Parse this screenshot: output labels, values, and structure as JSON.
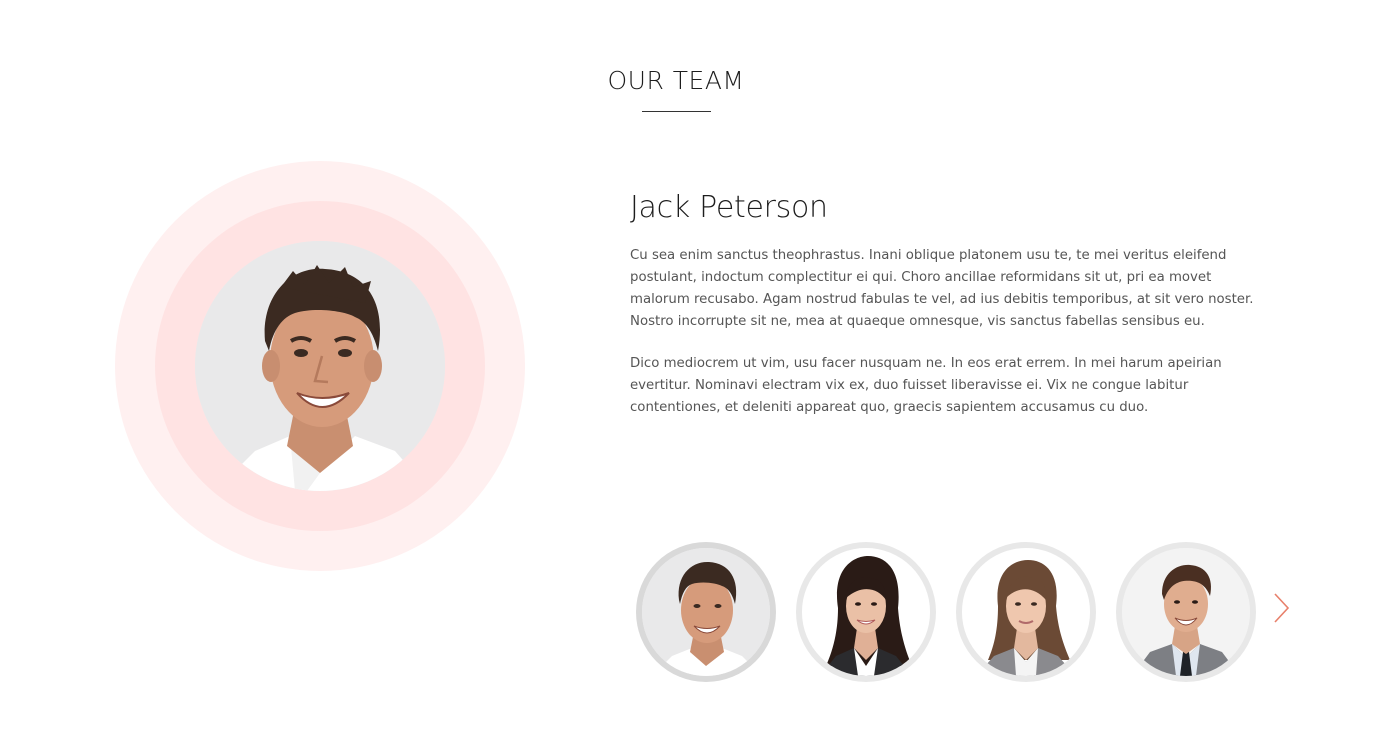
{
  "section": {
    "title": "OUR TEAM"
  },
  "member": {
    "name": "Jack Peterson",
    "bio": [
      "Cu sea enim sanctus theophrastus. Inani oblique platonem usu te, te mei veritus eleifend postulant, indoctum complectitur ei qui. Choro ancillae reformidans sit ut, pri ea movet malorum recusabo. Agam nostrud fabulas te vel, ad ius debitis temporibus, at sit vero noster. Nostro incorrupte sit ne, mea at quaeque omnesque, vis sanctus fabellas sensibus eu.",
      "Dico mediocrem ut vim, usu facer nusquam ne. In eos erat errem. In mei harum apeirian evertitur. Nominavi electram vix ex, duo fuisset liberavisse ei. Vix ne congue labitur contentiones, et deleniti appareat quo, graecis sapientem accusamus cu duo."
    ]
  },
  "thumbnails": [
    {
      "icon": "man-dark-hair-avatar",
      "active": true
    },
    {
      "icon": "woman-dark-hair-avatar",
      "active": false
    },
    {
      "icon": "woman-light-brown-hair-avatar",
      "active": false
    },
    {
      "icon": "man-suit-tie-avatar",
      "active": false
    }
  ],
  "controls": {
    "next_icon": "chevron-right-icon"
  },
  "colors": {
    "ring_outer": "#fff0f0",
    "ring_middle": "#ffe3e3",
    "accent": "#e8806b",
    "text": "#555555",
    "heading": "#1d1d1d"
  }
}
